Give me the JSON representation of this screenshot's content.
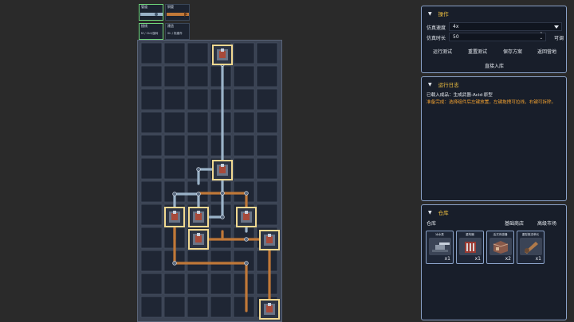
{
  "palette": [
    {
      "label": "管道",
      "sub": "",
      "selected": true
    },
    {
      "label": "铜管",
      "sub": "",
      "selected": false
    },
    {
      "label": "接线",
      "sub": "M / Ctrl/旋转",
      "selected": true
    },
    {
      "label": "建造",
      "sub": "Sh / 拖建件",
      "selected": false
    }
  ],
  "operations": {
    "title": "操作",
    "speed_label": "仿真速度",
    "speed_value": "4x",
    "duration_label": "仿真时长",
    "duration_value": "50",
    "duration_unit": "可调",
    "buttons": [
      "运行测试",
      "重置测试",
      "保存方案",
      "返回营地"
    ],
    "store_button": "直接入库"
  },
  "log": {
    "title": "运行日志",
    "lines": [
      {
        "text": "已载入成品：生成武器-Acid·原型",
        "color": "#e8ecf2"
      },
      {
        "text": "准备完成：选择组件后左键放置，左键拖拽可拉线，右键可拆除。",
        "color": "#f0a030"
      }
    ]
  },
  "warehouse": {
    "title": "仓库",
    "label": "仓库",
    "tabs": [
      "基础商店",
      "高级市场"
    ],
    "items": [
      {
        "name": "冰水泵",
        "count": "x1",
        "icon": "turret-icon"
      },
      {
        "name": "重构器",
        "count": "x1",
        "icon": "engine-icon"
      },
      {
        "name": "活式传感器",
        "count": "x2",
        "icon": "box-icon"
      },
      {
        "name": "重型推进单元",
        "count": "x1",
        "icon": "cannon-icon"
      }
    ]
  },
  "colors": {
    "accent": "#f0c040",
    "panel_border": "#8aa2c8",
    "copper": "#c07838",
    "steel": "#9ab2c8",
    "node": "#f0d890"
  }
}
